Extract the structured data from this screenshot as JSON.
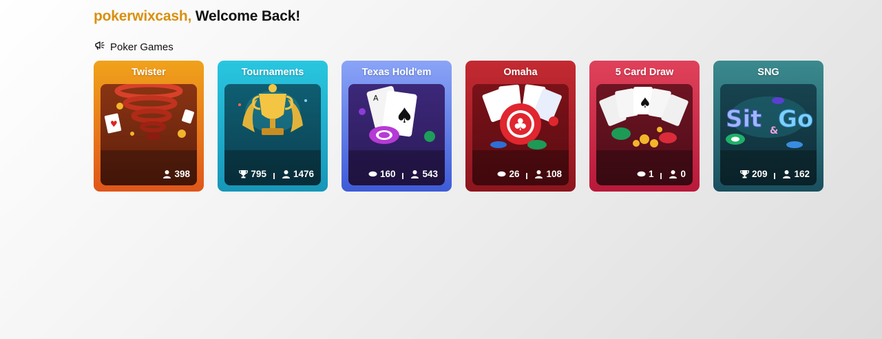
{
  "header": {
    "username": "pokerwixcash,",
    "welcome": "Welcome Back!"
  },
  "section": {
    "title": "Poker Games",
    "icon": "megaphone-icon"
  },
  "games": [
    {
      "title": "Twister",
      "stats": [
        {
          "icon": "players-icon",
          "value": "398"
        }
      ]
    },
    {
      "title": "Tournaments",
      "stats": [
        {
          "icon": "trophy-icon",
          "value": "795"
        },
        {
          "icon": "players-icon",
          "value": "1476"
        }
      ]
    },
    {
      "title": "Texas Hold'em",
      "stats": [
        {
          "icon": "tables-icon",
          "value": "160"
        },
        {
          "icon": "players-icon",
          "value": "543"
        }
      ]
    },
    {
      "title": "Omaha",
      "stats": [
        {
          "icon": "tables-icon",
          "value": "26"
        },
        {
          "icon": "players-icon",
          "value": "108"
        }
      ]
    },
    {
      "title": "5 Card Draw",
      "stats": [
        {
          "icon": "tables-icon",
          "value": "1"
        },
        {
          "icon": "players-icon",
          "value": "0"
        }
      ]
    },
    {
      "title": "SNG",
      "stats": [
        {
          "icon": "trophy-icon",
          "value": "209"
        },
        {
          "icon": "players-icon",
          "value": "162"
        }
      ]
    }
  ],
  "colors": {
    "username": "#d9900f",
    "text": "#111111"
  }
}
